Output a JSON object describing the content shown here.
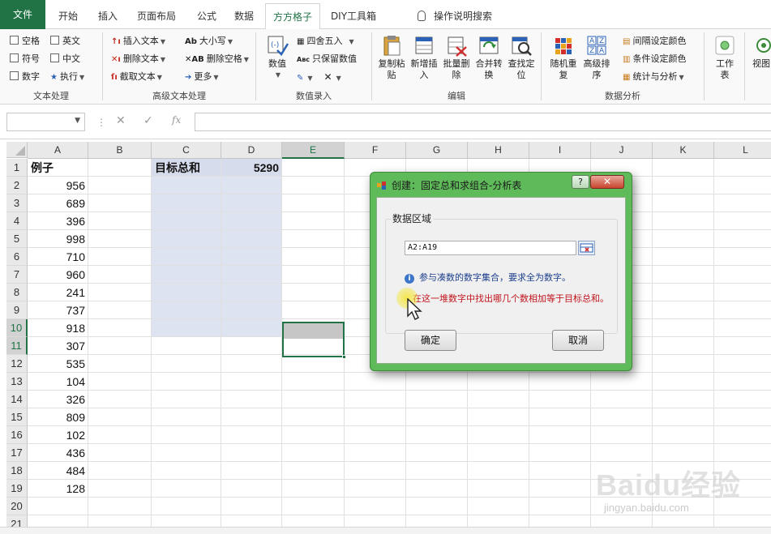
{
  "ribbon_tabs": [
    "文件",
    "开始",
    "插入",
    "页面布局",
    "公式",
    "数据",
    "方方格子",
    "DIY工具箱"
  ],
  "active_tab": "方方格子",
  "tell_me": "操作说明搜索",
  "ribbon": {
    "text_group": {
      "items": [
        "空格",
        "英文",
        "符号",
        "中文",
        "数字",
        "执行"
      ],
      "label": "文本处理"
    },
    "adv_text_group": {
      "items": [
        "插入文本",
        "大小写",
        "删除文本",
        "删除空格",
        "截取文本",
        "更多"
      ],
      "label": "高级文本处理"
    },
    "num_group": {
      "items": [
        "数值",
        "四舍五入",
        "只保留数值"
      ],
      "label": "数值录入"
    },
    "edit_group": {
      "items": [
        "复制粘\n贴",
        "新增插\n入",
        "批量删\n除",
        "合并转\n换",
        "查找定\n位"
      ],
      "label": "编辑"
    },
    "analysis_group": {
      "items": [
        "随机重\n复",
        "高级排\n序",
        "间隔设定颜色",
        "条件设定颜色",
        "统计与分析"
      ],
      "label": "数据分析"
    },
    "work_group": {
      "items": [
        "工作\n表",
        "视图"
      ]
    }
  },
  "formula_bar": {
    "fx_label": "fx"
  },
  "sheet": {
    "columns": [
      "A",
      "B",
      "C",
      "D",
      "E",
      "F",
      "G",
      "H",
      "I",
      "J",
      "K",
      "L"
    ],
    "selected_column": "E",
    "rows": [
      "1",
      "2",
      "3",
      "4",
      "5",
      "6",
      "7",
      "8",
      "9",
      "10",
      "11",
      "12",
      "13",
      "14",
      "15",
      "16",
      "17",
      "18",
      "19",
      "20",
      "21"
    ],
    "selected_rows": [
      "10",
      "11"
    ],
    "a1_header": "例子",
    "a_values": [
      "956",
      "689",
      "396",
      "998",
      "710",
      "960",
      "241",
      "737",
      "918",
      "307",
      "535",
      "104",
      "326",
      "809",
      "102",
      "436",
      "484",
      "128"
    ],
    "c1_label": "目标总和",
    "d1_value": "5290"
  },
  "dialog": {
    "title": "创建：固定总和求组合-分析表",
    "help": "?",
    "close": "✕",
    "group_label": "数据区域",
    "range_value": "A2:A19",
    "info_icon": "i",
    "info_text": "参与凑数的数字集合，要求全为数字。",
    "warn_text": "在这一堆数字中找出哪几个数相加等于目标总和。",
    "ok_label": "确定",
    "cancel_label": "取消"
  },
  "watermark": {
    "main": "Baidu经验",
    "sub": "jingyan.baidu.com"
  }
}
